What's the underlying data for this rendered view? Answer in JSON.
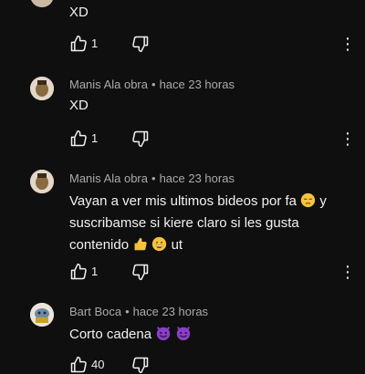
{
  "comments": [
    {
      "author": "",
      "time": "",
      "text": "XD",
      "likes": "1"
    },
    {
      "author": "Manis Ala obra",
      "time": "hace 23 horas",
      "text": "XD",
      "likes": "1"
    },
    {
      "author": "Manis Ala obra",
      "time": "hace 23 horas",
      "text_line1": "Vayan a ver mis ultimos bideos por fa",
      "text_line1_end": "y",
      "text_line2": "suscribamse si kiere claro si les gusta",
      "text_line3": "contenido",
      "text_line3_end": "ut",
      "likes": "1"
    },
    {
      "author": "Bart Boca",
      "time": "hace 23 horas",
      "text": "Corto cadena",
      "likes": "40"
    }
  ],
  "separator": "•",
  "icons": {
    "like": "thumbs-up-icon",
    "dislike": "thumbs-down-icon",
    "more": "more-vertical-icon",
    "emoji_pensive": "pensive-face-emoji",
    "emoji_thumbs": "thumbs-up-emoji",
    "emoji_grin": "grinning-face-emoji",
    "emoji_devil": "smiling-devil-emoji"
  },
  "colors": {
    "background": "#0f0f0f",
    "text": "#f1f1f1",
    "meta": "#aaaaaa"
  }
}
